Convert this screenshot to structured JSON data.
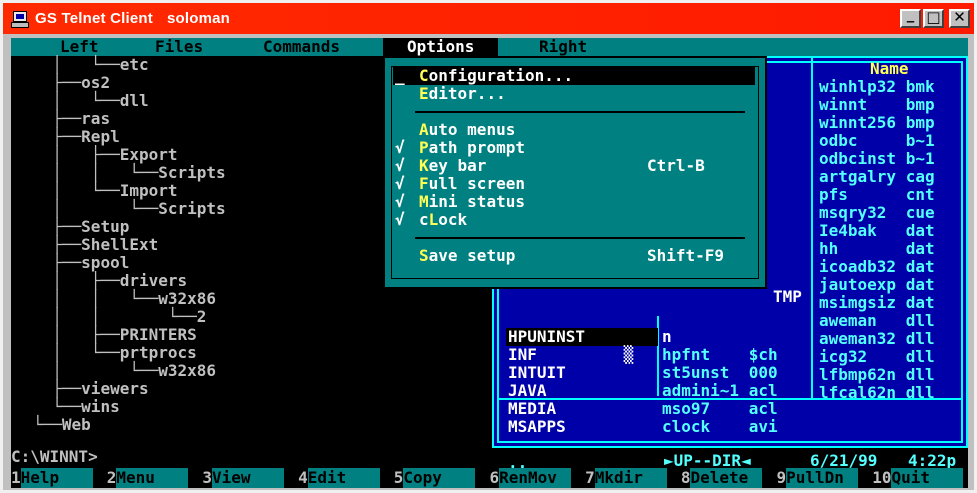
{
  "window": {
    "title": "GS Telnet Client",
    "host": "soloman",
    "buttons": {
      "minimize": "_",
      "maximize": "□",
      "close": "✕"
    }
  },
  "menubar": [
    "Left",
    "Files",
    "Commands",
    "Options",
    "Right"
  ],
  "active_menu": "Options",
  "tree": [
    {
      "prefix": "  │   └──",
      "name": "etc"
    },
    {
      "prefix": "  ├──",
      "name": "os2"
    },
    {
      "prefix": "  │   └──",
      "name": "dll"
    },
    {
      "prefix": "  ├──",
      "name": "ras"
    },
    {
      "prefix": "  ├──",
      "name": "Repl"
    },
    {
      "prefix": "  │   ├──",
      "name": "Export"
    },
    {
      "prefix": "  │   │   └──",
      "name": "Scripts"
    },
    {
      "prefix": "  │   └──",
      "name": "Import"
    },
    {
      "prefix": "  │       └──",
      "name": "Scripts"
    },
    {
      "prefix": "  ├──",
      "name": "Setup"
    },
    {
      "prefix": "  ├──",
      "name": "ShellExt"
    },
    {
      "prefix": "  ├──",
      "name": "spool"
    },
    {
      "prefix": "  │   ├──",
      "name": "drivers"
    },
    {
      "prefix": "  │   │   └──",
      "name": "w32x86"
    },
    {
      "prefix": "  │   │       └──",
      "name": "2"
    },
    {
      "prefix": "  │   ├──",
      "name": "PRINTERS"
    },
    {
      "prefix": "  │   └──",
      "name": "prtprocs"
    },
    {
      "prefix": "  │       └──",
      "name": "w32x86"
    },
    {
      "prefix": "  ├──",
      "name": "viewers"
    },
    {
      "prefix": "  └──",
      "name": "wins"
    },
    {
      "prefix": "└──",
      "name": "Web"
    }
  ],
  "options_menu": {
    "items": [
      {
        "hotkey": "C",
        "rest": "onfiguration...",
        "check": "",
        "shortcut": "",
        "selected": true,
        "marker": "_"
      },
      {
        "hotkey": "E",
        "rest": "ditor...",
        "check": "",
        "shortcut": ""
      },
      {
        "separator": true
      },
      {
        "hotkey": "A",
        "rest": "uto menus",
        "check": "",
        "shortcut": ""
      },
      {
        "hotkey": "P",
        "rest": "ath prompt",
        "check": "√",
        "shortcut": ""
      },
      {
        "hotkey": "K",
        "rest": "ey bar",
        "check": "√",
        "shortcut": "Ctrl-B"
      },
      {
        "hotkey": "F",
        "rest": "ull screen",
        "check": "√",
        "shortcut": ""
      },
      {
        "hotkey": "M",
        "rest": "ini status",
        "check": "√",
        "shortcut": ""
      },
      {
        "pre": "c",
        "hotkey": "L",
        "rest": "ock",
        "check": "√",
        "shortcut": ""
      },
      {
        "separator": true
      },
      {
        "hotkey": "S",
        "rest": "ave setup",
        "check": "",
        "shortcut": "Shift-F9"
      }
    ]
  },
  "panel": {
    "header": "Name",
    "tmp_label": "TMP",
    "col1": [
      "HPUNINST",
      "INF",
      "INTUIT",
      "JAVA",
      "MEDIA",
      "MSAPPS"
    ],
    "col1_shade": [
      "",
      "▒",
      "",
      "",
      "",
      ""
    ],
    "col2": [
      [
        "n",
        ""
      ],
      [
        "hpfnt",
        "$ch"
      ],
      [
        "st5unst",
        "000"
      ],
      [
        "admini~1",
        "acl"
      ],
      [
        "mso97",
        "acl"
      ],
      [
        "clock",
        "avi"
      ]
    ],
    "col3": [
      [
        "winhlp32",
        "bmk"
      ],
      [
        "winnt",
        "bmp"
      ],
      [
        "winnt256",
        "bmp"
      ],
      [
        "odbc",
        "b~1"
      ],
      [
        "odbcinst",
        "b~1"
      ],
      [
        "artgalry",
        "cag"
      ],
      [
        "pfs",
        "cnt"
      ],
      [
        "msqry32",
        "cue"
      ],
      [
        "Ie4bak",
        "dat"
      ],
      [
        "hh",
        "dat"
      ],
      [
        "icoadb32",
        "dat"
      ],
      [
        "jautoexp",
        "dat"
      ],
      [
        "msimgsiz",
        "dat"
      ],
      [
        "aweman",
        "dll"
      ],
      [
        "aweman32",
        "dll"
      ],
      [
        "icg32",
        "dll"
      ],
      [
        "lfbmp62n",
        "dll"
      ],
      [
        "lfcal62n",
        "dll"
      ]
    ],
    "status": {
      "left": "..",
      "type": "►UP--DIR◄",
      "date": "6/21/99",
      "time": "4:22p"
    }
  },
  "prompt": "C:\\WINNT>",
  "fkeys": [
    {
      "num": "1",
      "label": "Help"
    },
    {
      "num": "2",
      "label": "Menu"
    },
    {
      "num": "3",
      "label": "View"
    },
    {
      "num": "4",
      "label": "Edit"
    },
    {
      "num": "5",
      "label": "Copy"
    },
    {
      "num": "6",
      "label": "RenMov"
    },
    {
      "num": "7",
      "label": "Mkdir"
    },
    {
      "num": "8",
      "label": "Delete"
    },
    {
      "num": "9",
      "label": "PullDn"
    },
    {
      "num": "10",
      "label": "Quit"
    }
  ],
  "colors": {
    "titlebar": "#ff1a00",
    "menubar": "#008080",
    "panel_bg": "#0000a8",
    "panel_text": "#54ffff",
    "hotkey": "#ffff54"
  }
}
